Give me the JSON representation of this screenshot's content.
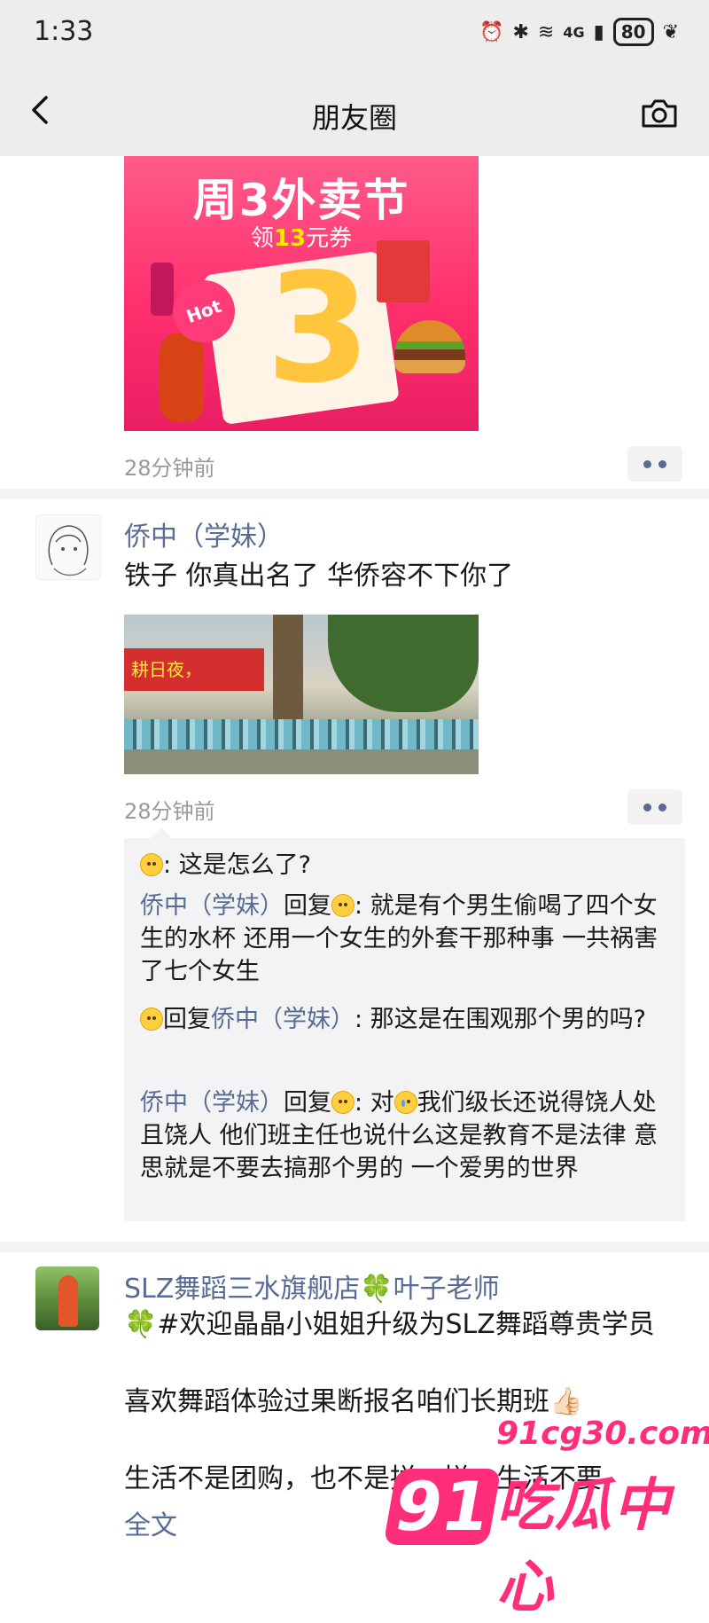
{
  "status_bar": {
    "time": "1:33",
    "signal_label": "4G",
    "battery": "80"
  },
  "nav": {
    "title": "朋友圈",
    "back_icon": "chevron-left-icon",
    "camera_icon": "camera-icon"
  },
  "posts": [
    {
      "ad": {
        "title": "周3外卖节",
        "sub_prefix": "领",
        "sub_amount": "13",
        "sub_suffix": "元券",
        "hot": "Hot",
        "big_number": "3"
      },
      "time_ago": "28分钟前"
    },
    {
      "author": "侨中（学妹）",
      "text": "铁子 你真出名了 华侨容不下你了",
      "photo_banner": "耕日夜，",
      "time_ago": "28分钟前",
      "comments": [
        {
          "author": "",
          "reply_to": "",
          "text": ": 这是怎么了?"
        },
        {
          "author": "侨中（学妹）",
          "reply_word": "回复",
          "text": ": 就是有个男生偷喝了四个女生的水杯 还用一个女生的外套干那种事 一共祸害了七个女生"
        },
        {
          "reply_word": "回复",
          "reply_to": "侨中（学妹）",
          "text": ": 那这是在围观那个男的吗?"
        },
        {
          "author": "侨中（学妹）",
          "reply_word": "回复",
          "text_a": ": 对",
          "text_b": "我们级长还说得饶人处且饶人 他们班主任也说什么这是教育不是法律 意思就是不要去搞那个男的  一个爱男的世界"
        }
      ]
    },
    {
      "author": "SLZ舞蹈三水旗舰店🍀叶子老师",
      "line1": "🍀#欢迎晶晶小姐姐升级为SLZ舞蹈尊贵学员",
      "line2": "喜欢舞蹈体验过果断报名咱们长期班👍🏻",
      "line3": "生活不是团购，也不是拼一拼，生活不要",
      "fold_label": "全文"
    }
  ],
  "watermark": {
    "logo": "91",
    "url": "91cg30.com",
    "name": "吃瓜中心"
  }
}
